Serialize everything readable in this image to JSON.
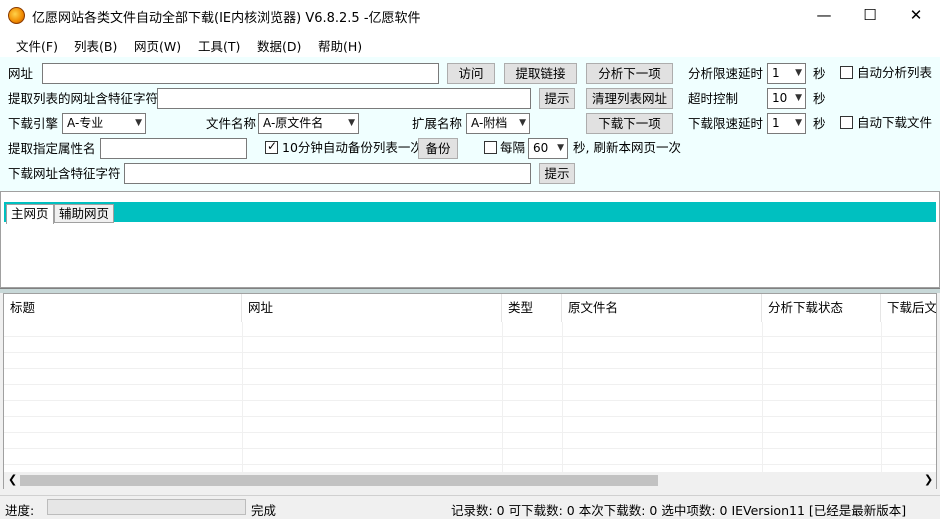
{
  "window": {
    "title": "亿愿网站各类文件自动全部下载(IE内核浏览器) V6.8.2.5 -亿愿软件",
    "minimize": "—",
    "maximize": "☐",
    "close": "✕"
  },
  "menu": [
    "文件(F)",
    "列表(B)",
    "网页(W)",
    "工具(T)",
    "数据(D)",
    "帮助(H)"
  ],
  "form": {
    "url_label": "网址",
    "url_value": "",
    "visit_button": "访问",
    "extract_links_button": "提取链接",
    "analyze_next_button": "分析下一项",
    "analyze_delay_label": "分析限速延时",
    "analyze_delay_value": "1",
    "seconds1": "秒",
    "auto_analyze_label": "自动分析列表",
    "auto_analyze_checked": false,
    "list_url_feature_label": "提取列表的网址含特征字符",
    "list_url_feature_value": "",
    "hint_button_1": "提示",
    "clear_list_button": "清理列表网址",
    "timeout_label": "超时控制",
    "timeout_value": "10",
    "seconds2": "秒",
    "engine_label": "下载引擎",
    "engine_value": "A-专业",
    "filename_label": "文件名称",
    "filename_value": "A-原文件名",
    "ext_label": "扩展名称",
    "ext_value": "A-附档",
    "download_next_button": "下载下一项",
    "download_delay_label": "下载限速延时",
    "download_delay_value": "1",
    "seconds3": "秒",
    "auto_download_label": "自动下载文件",
    "auto_download_checked": false,
    "attr_label": "提取指定属性名",
    "attr_value": "",
    "backup_label": "10分钟自动备份列表一次",
    "backup_checked": true,
    "backup_button": "备份",
    "every_label": "每隔",
    "every_checked": false,
    "every_value": "60",
    "refresh_label": "秒, 刷新本网页一次",
    "download_url_feature_label": "下载网址含特征字符",
    "download_url_feature_value": "",
    "hint_button_2": "提示"
  },
  "tabs": [
    "主网页",
    "辅助网页"
  ],
  "list": {
    "columns": [
      "标题",
      "网址",
      "类型",
      "原文件名",
      "分析下载状态",
      "下载后文"
    ]
  },
  "status": {
    "progress_label": "进度:",
    "progress_value": 0,
    "state": "完成",
    "summary": "记录数: 0  可下载数: 0  本次下载数: 0  选中项数: 0  IEVersion11  [已经是最新版本]"
  }
}
